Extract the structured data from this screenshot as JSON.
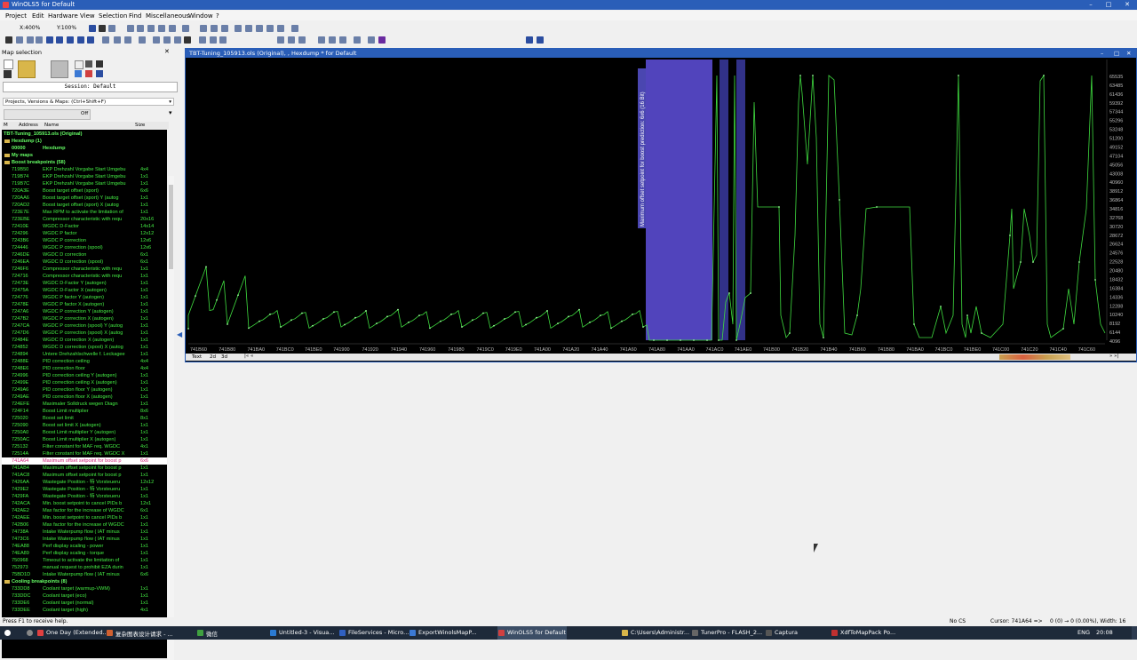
{
  "window": {
    "title": "WinOLS5 for Default"
  },
  "menu": [
    "Project",
    "Edit",
    "Hardware",
    "View",
    "Selection",
    "Find",
    "Miscellaneous",
    "Window",
    "?"
  ],
  "toolbar": {
    "zoom_x": "X:400%",
    "zoom_y": "Y:100%"
  },
  "panel": {
    "title": "Map selection",
    "session": "Session: Default",
    "projects_label": "Projects, Versions & Maps: (Ctrl+Shift+F)",
    "columns": {
      "m": "M",
      "address": "Address",
      "name": "Name",
      "size": "Size"
    },
    "search_placeholder": "Off"
  },
  "tree": {
    "project": "TBT-Tuning_105913.ols (Original)",
    "folders": [
      {
        "label": "Hexdump (1)"
      },
      {
        "label": "My maps"
      },
      {
        "label": "Boost breakpoints (58)"
      },
      {
        "label": "Cooling breakpoints (8)"
      }
    ],
    "hexdump_item": {
      "address": "00000",
      "name": "Hexdump"
    },
    "rows": [
      {
        "a": "719B50",
        "n": "EKP Drehzahl Vorgabe Start Umgebu",
        "s": "4x4"
      },
      {
        "a": "719B74",
        "n": "EKP Drehzahl Vorgabe Start Umgebu",
        "s": "1x1"
      },
      {
        "a": "719B7C",
        "n": "EKP Drehzahl Vorgabe Start Umgebu",
        "s": "1x1"
      },
      {
        "a": "720A3E",
        "n": "Boost target offset (sport)",
        "s": "6x6"
      },
      {
        "a": "720AA6",
        "n": "Boost target offset (sport) Y (autog",
        "s": "1x1"
      },
      {
        "a": "720AD2",
        "n": "Boost target offset (sport) X (autog",
        "s": "1x1"
      },
      {
        "a": "723E7E",
        "n": "Max RPM to activate the limitation of",
        "s": "1x1"
      },
      {
        "a": "723EBE",
        "n": "Compressor characteristic with requ",
        "s": "20x16"
      },
      {
        "a": "72410E",
        "n": "WGDC D-Factor",
        "s": "14x14"
      },
      {
        "a": "724296",
        "n": "WGDC P factor",
        "s": "12x12"
      },
      {
        "a": "7243B6",
        "n": "WGDC P correction",
        "s": "12x6"
      },
      {
        "a": "724446",
        "n": "WGDC P correction (spool)",
        "s": "12x6"
      },
      {
        "a": "7246DE",
        "n": "WGDC D correction",
        "s": "6x1"
      },
      {
        "a": "7246EA",
        "n": "WGDC D correction (spool)",
        "s": "6x1"
      },
      {
        "a": "7246F6",
        "n": "Compressor characteristic with requ",
        "s": "1x1"
      },
      {
        "a": "724716",
        "n": "Compressor characteristic with requ",
        "s": "1x1"
      },
      {
        "a": "72473E",
        "n": "WGDC D-Factor Y (autogen)",
        "s": "1x1"
      },
      {
        "a": "72475A",
        "n": "WGDC D-Factor X (autogen)",
        "s": "1x1"
      },
      {
        "a": "724776",
        "n": "WGDC P factor Y (autogen)",
        "s": "1x1"
      },
      {
        "a": "72478E",
        "n": "WGDC P factor X (autogen)",
        "s": "1x1"
      },
      {
        "a": "7247A6",
        "n": "WGDC P correction Y (autogen)",
        "s": "1x1"
      },
      {
        "a": "7247B2",
        "n": "WGDC P correction X (autogen)",
        "s": "1x1"
      },
      {
        "a": "7247CA",
        "n": "WGDC P correction (spool) Y (autog",
        "s": "1x1"
      },
      {
        "a": "7247D6",
        "n": "WGDC P correction (spool) X (autog",
        "s": "1x1"
      },
      {
        "a": "72484E",
        "n": "WGDC D correction X (autogen)",
        "s": "1x1"
      },
      {
        "a": "724852",
        "n": "WGDC D correction (spool) X (autog",
        "s": "1x1"
      },
      {
        "a": "724894",
        "n": "Untere Drehzahlschwelle f. Leckagee",
        "s": "1x1"
      },
      {
        "a": "72488E",
        "n": "PID correction ceiling",
        "s": "4x4"
      },
      {
        "a": "7248E6",
        "n": "PID correction floor",
        "s": "4x4"
      },
      {
        "a": "724996",
        "n": "PID correction ceiling Y (autogen)",
        "s": "1x1"
      },
      {
        "a": "72499E",
        "n": "PID correction ceiling X (autogen)",
        "s": "1x1"
      },
      {
        "a": "7249A6",
        "n": "PID correction floor Y (autogen)",
        "s": "1x1"
      },
      {
        "a": "7249AE",
        "n": "PID correction floor X (autogen)",
        "s": "1x1"
      },
      {
        "a": "724EFE",
        "n": "Maximaler Solldruck wegen Diagn",
        "s": "1x1"
      },
      {
        "a": "724F14",
        "n": "Boost Limit multiplier",
        "s": "8x6"
      },
      {
        "a": "725020",
        "n": "Boost set limit",
        "s": "8x1"
      },
      {
        "a": "725090",
        "n": "Boost set limit X (autogen)",
        "s": "1x1"
      },
      {
        "a": "7250A0",
        "n": "Boost Limit multiplier Y (autogen)",
        "s": "1x1"
      },
      {
        "a": "7250AC",
        "n": "Boost Limit multiplier X (autogen)",
        "s": "1x1"
      },
      {
        "a": "725132",
        "n": "Filter constant for MAF req. WGDC",
        "s": "4x1"
      },
      {
        "a": "72514A",
        "n": "Filter constant for MAF req. WGDC X",
        "s": "1x1"
      },
      {
        "a": "741A64",
        "n": "Maximum offset setpoint for boost p",
        "s": "6x6",
        "selected": true
      },
      {
        "a": "741AB4",
        "n": "Maximum offset setpoint for boost p",
        "s": "1x1"
      },
      {
        "a": "741AC8",
        "n": "Maximum offset setpoint for boost p",
        "s": "1x1"
      },
      {
        "a": "7426AA",
        "n": "Wastegate Position - 特 Vorsteueru",
        "s": "12x12"
      },
      {
        "a": "7429E2",
        "n": "Wastegate Position - 特 Vorsteueru",
        "s": "1x1"
      },
      {
        "a": "7429FA",
        "n": "Wastegate Position - 特 Vorsteueru",
        "s": "1x1"
      },
      {
        "a": "742ACA",
        "n": "Min. boost setpoint to cancel PIDs b",
        "s": "12x1"
      },
      {
        "a": "742AE2",
        "n": "Max factor for the increase of WGDC",
        "s": "6x1"
      },
      {
        "a": "742AEE",
        "n": "Min. boost setpoint to cancel PIDs b",
        "s": "1x1"
      },
      {
        "a": "742B06",
        "n": "Max factor for the increase of WGDC",
        "s": "1x1"
      },
      {
        "a": "74738A",
        "n": "Intake Waterpump flow ( IAT minus",
        "s": "1x1"
      },
      {
        "a": "7473C6",
        "n": "Intake Waterpump flow ( IAT minus",
        "s": "1x1"
      },
      {
        "a": "74EA88",
        "n": "Perf display scaling - power",
        "s": "1x1"
      },
      {
        "a": "74EA89",
        "n": "Perf display scaling - torque",
        "s": "1x1"
      },
      {
        "a": "750968",
        "n": "Timeout to activate the limitation of",
        "s": "1x1"
      },
      {
        "a": "752973",
        "n": "manual request to prohibit EZA durin",
        "s": "1x1"
      },
      {
        "a": "75BD1D",
        "n": "Intake Waterpump flow ( IAT minus",
        "s": "6x6"
      }
    ],
    "cooling_rows": [
      {
        "a": "733DD8",
        "n": "Coolant target (warmup-VWM)",
        "s": "1x1"
      },
      {
        "a": "733DDC",
        "n": "Coolant target (eco)",
        "s": "1x1"
      },
      {
        "a": "733DE6",
        "n": "Coolant target (normal)",
        "s": "1x1"
      },
      {
        "a": "733DEE",
        "n": "Coolant target (high)",
        "s": "4x1"
      }
    ]
  },
  "hexwin": {
    "title": "TBT-Tuning_105913.ols (Original), , Hexdump * for Default",
    "selection_label": "Maximum offset setpoint for boost prediction: 6x6 (16 Bit)",
    "mode_tabs": [
      "Text",
      "2d",
      "3d"
    ],
    "x_ticks": [
      "741B60",
      "741B80",
      "741BA0",
      "741BC0",
      "741BE0",
      "741900",
      "741920",
      "741940",
      "741960",
      "741980",
      "7419C0",
      "7419E0",
      "741A00",
      "741A20",
      "741A40",
      "741A60",
      "741A80",
      "741AA0",
      "741AC0",
      "741AE0",
      "741B00",
      "741B20",
      "741B40",
      "741B60",
      "741B80",
      "741BA0",
      "741BC0",
      "741BE0",
      "741C00",
      "741C20",
      "741C40",
      "741C60"
    ],
    "y_ticks": [
      "65535",
      "63485",
      "61436",
      "59392",
      "57344",
      "55296",
      "53248",
      "51200",
      "49152",
      "47104",
      "45056",
      "43008",
      "40960",
      "38912",
      "36864",
      "34816",
      "32768",
      "30720",
      "28672",
      "26624",
      "24576",
      "22528",
      "20480",
      "18432",
      "16384",
      "14336",
      "12288",
      "10240",
      "8192",
      "6144",
      "4096"
    ]
  },
  "status": {
    "help": "Press F1 to receive help.",
    "checksum": "No CS",
    "cursor": "Cursor: 741A64 =>",
    "info": "0 (0) → 0 (0.00%), Width: 16"
  },
  "taskbar": {
    "items": [
      "One Day (Extended...",
      "复杂图表设计请求 - ...",
      "微信",
      "Untitled-3 - Visua...",
      "FileServices - Micro...",
      "ExportWinolsMapP...",
      "WinOLS5 for Default",
      "C:\\Users\\Administr...",
      "TunerPro - FLASH_2...",
      "Captura",
      "XdfToMapPack Po..."
    ],
    "lang": "ENG",
    "time": "20:08"
  },
  "colors": {
    "accent": "#2a5eb8",
    "graph": "#3fdc3f",
    "selection": "#5a4bd0"
  }
}
